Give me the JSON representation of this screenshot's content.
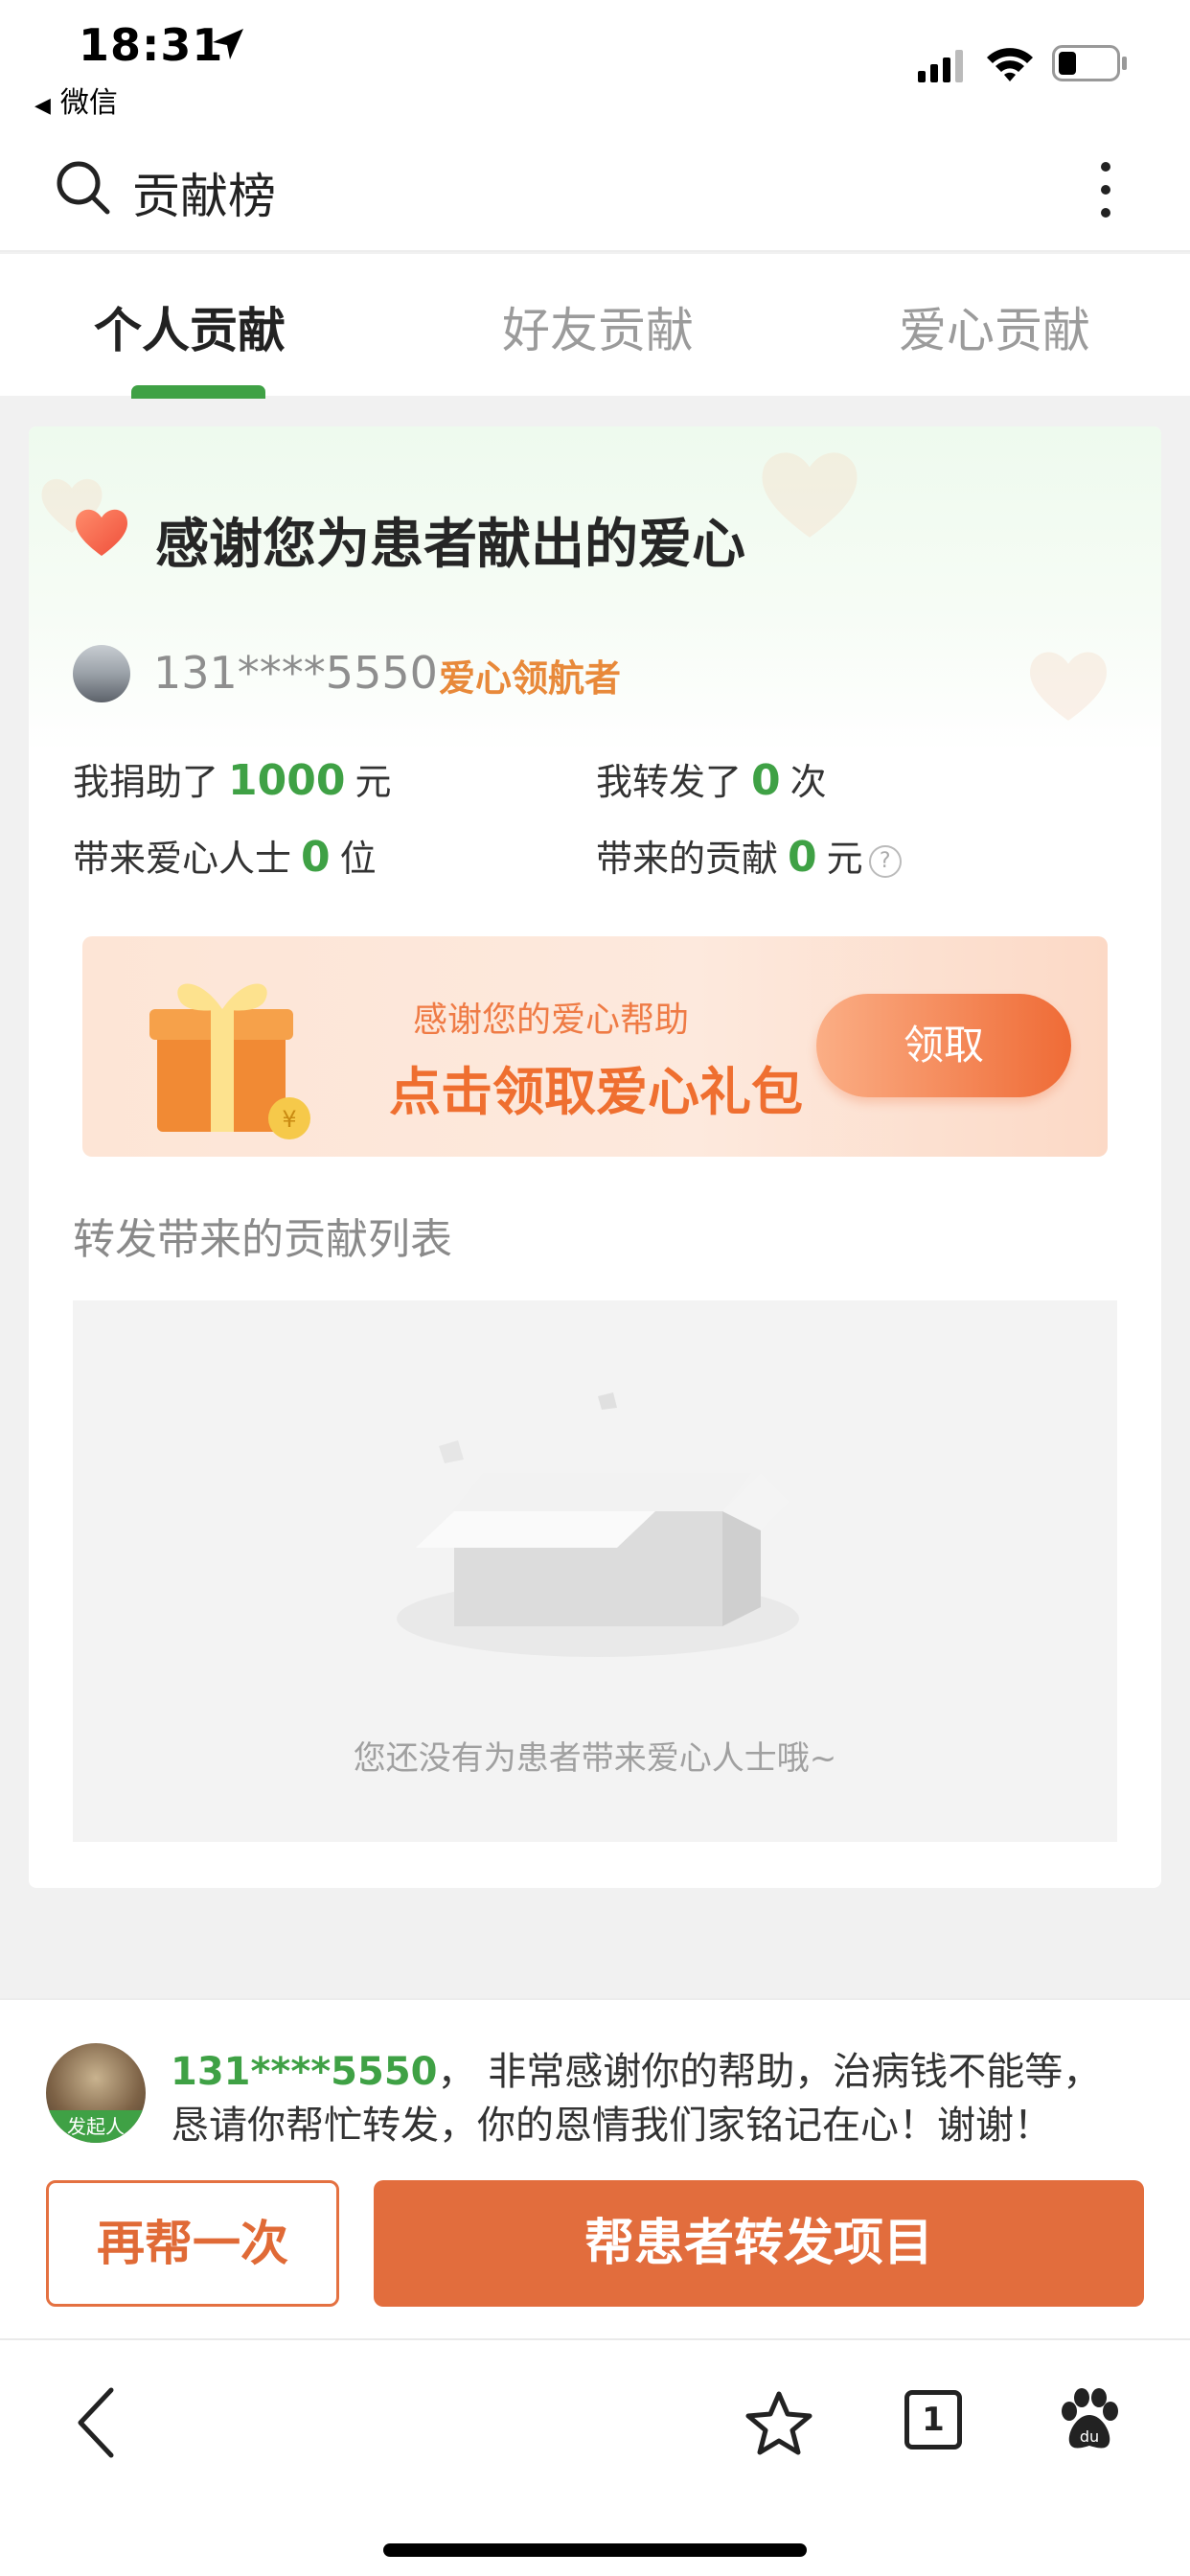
{
  "status_bar": {
    "time": "18:31",
    "back_app": "微信"
  },
  "header": {
    "title": "贡献榜"
  },
  "tabs": [
    {
      "label": "个人贡献",
      "active": true
    },
    {
      "label": "好友贡献",
      "active": false
    },
    {
      "label": "爱心贡献",
      "active": false
    }
  ],
  "card": {
    "thanks_title": "感谢您为患者献出的爱心",
    "user_phone": "131****5550",
    "user_badge": "爱心领航者",
    "stats": {
      "donated_prefix": "我捐助了",
      "donated_value": "1000",
      "donated_unit": "元",
      "shared_prefix": "我转发了",
      "shared_value": "0",
      "shared_unit": "次",
      "brought_prefix": "带来爱心人士",
      "brought_value": "0",
      "brought_unit": "位",
      "contrib_prefix": "带来的贡献",
      "contrib_value": "0",
      "contrib_unit": "元"
    },
    "gift": {
      "subtitle": "感谢您的爱心帮助",
      "title": "点击领取爱心礼包",
      "button": "领取"
    },
    "list_title": "转发带来的贡献列表",
    "empty_text": "您还没有为患者带来爱心人士哦~"
  },
  "message": {
    "initiator_label": "发起人",
    "name": "131****5550",
    "line1_rest": "， 非常感谢你的帮助，治病钱不能等，",
    "line2": "恳请你帮忙转发，你的恩情我们家铭记在心！谢谢！"
  },
  "actions": {
    "again": "再帮一次",
    "share": "帮患者转发项目"
  },
  "browser": {
    "tab_count": "1"
  },
  "colors": {
    "brand_green": "#3fa145",
    "accent_orange": "#e26d3d",
    "badge_orange": "#e8893a"
  }
}
